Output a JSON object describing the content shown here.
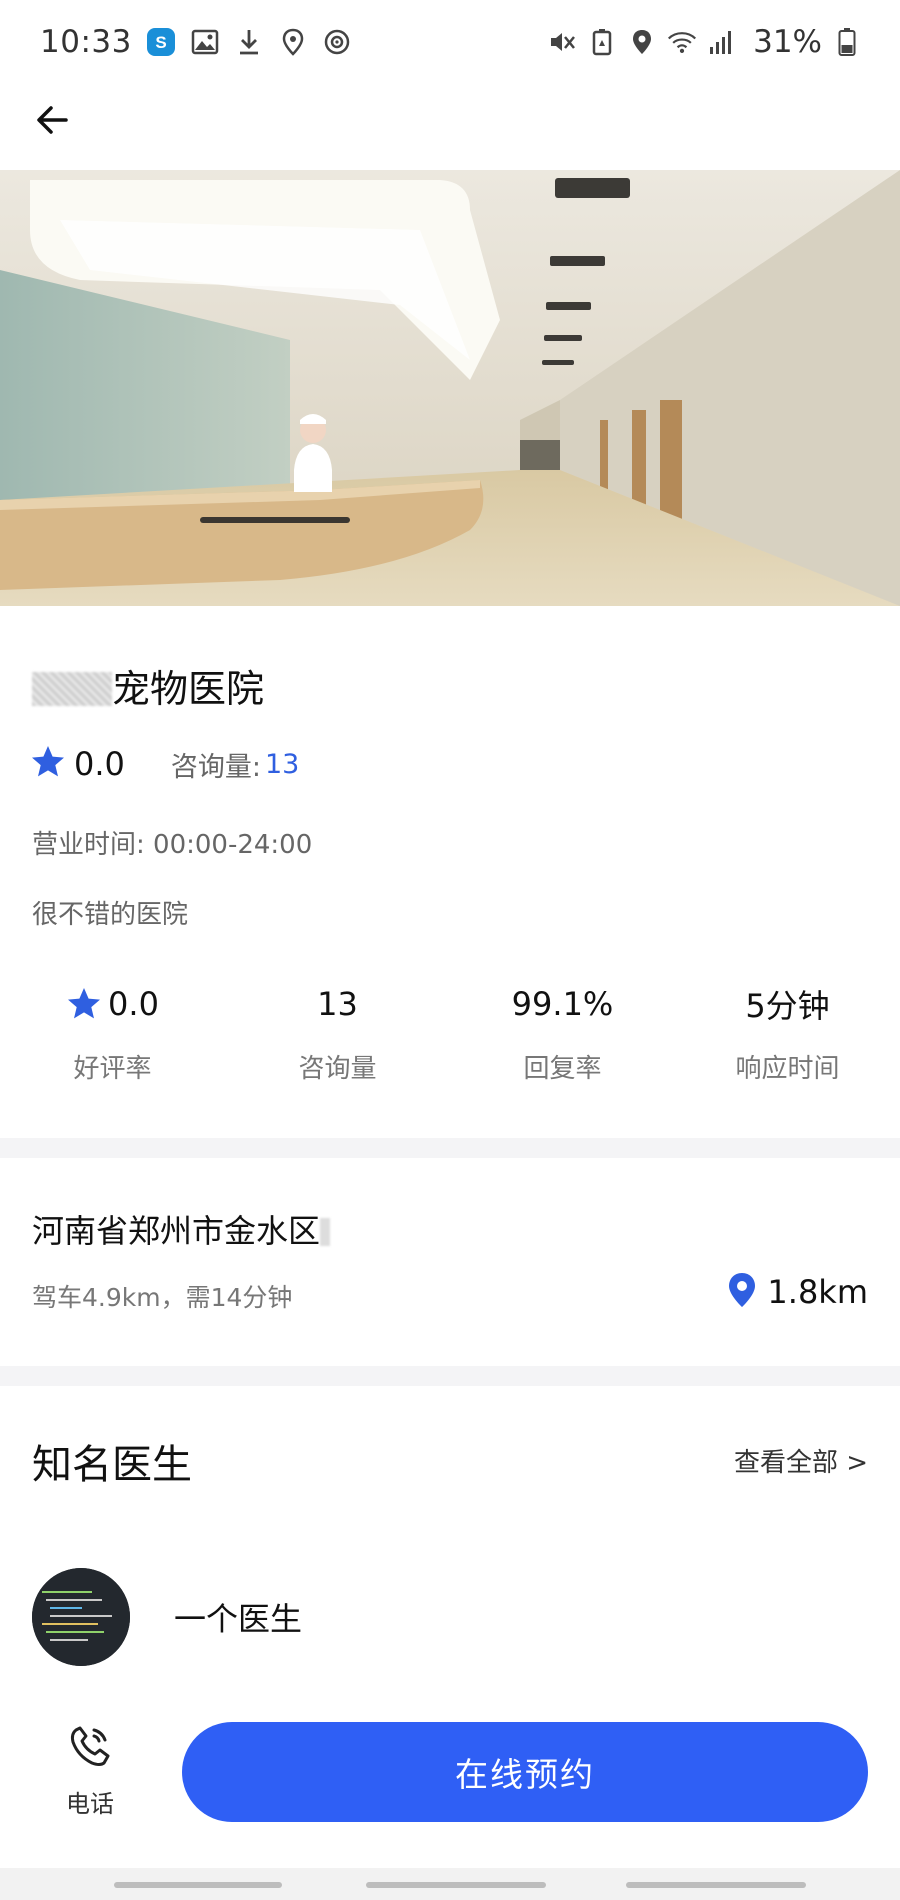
{
  "status_bar": {
    "time": "10:33",
    "battery": "31%"
  },
  "hospital": {
    "name": "宠物医院",
    "rating": "0.0",
    "consult_label": "咨询量:",
    "consult_count": "13",
    "hours": "营业时间: 00:00-24:00",
    "description": "很不错的医院"
  },
  "stats": [
    {
      "value": "0.0",
      "label": "好评率"
    },
    {
      "value": "13",
      "label": "咨询量"
    },
    {
      "value": "99.1%",
      "label": "回复率"
    },
    {
      "value": "5分钟",
      "label": "响应时间"
    }
  ],
  "address": {
    "title": "河南省郑州市金水区",
    "drive": "驾车4.9km，需14分钟",
    "distance": "1.8km"
  },
  "doctors": {
    "heading": "知名医生",
    "view_all": "查看全部 >",
    "items": [
      {
        "name": "一个医生"
      }
    ]
  },
  "actions": {
    "phone_label": "电话",
    "book_label": "在线预约"
  },
  "colors": {
    "accent": "#2f5ff5",
    "star": "#2f5fe0"
  }
}
